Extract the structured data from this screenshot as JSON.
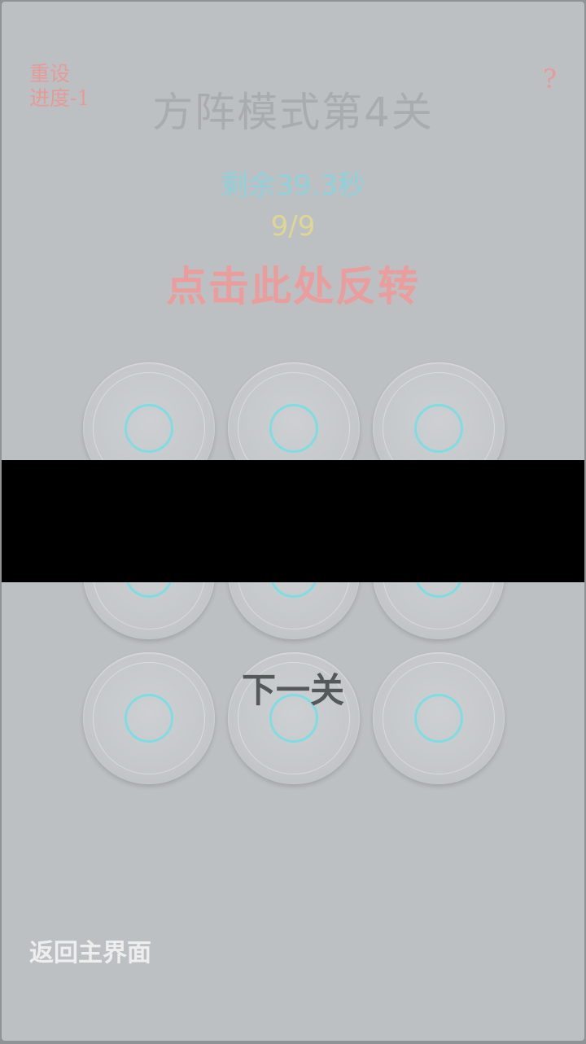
{
  "header": {
    "reset_line1": "重设",
    "reset_line2": "进度-1",
    "help": "?",
    "title": "方阵模式第4关"
  },
  "status": {
    "timer": "剩余39.3秒",
    "progress": "9/9",
    "invert_action": "点击此处反转"
  },
  "grid": {
    "rows": 3,
    "cols": 3,
    "cells_total": 9
  },
  "actions": {
    "next_level": "下一关",
    "back_home": "返回主界面"
  },
  "colors": {
    "ring": "#7fdde2",
    "timer": "#8fd1db",
    "progress": "#dfd691",
    "invert": "#eb9c9c",
    "background": "#bdc0c2"
  }
}
